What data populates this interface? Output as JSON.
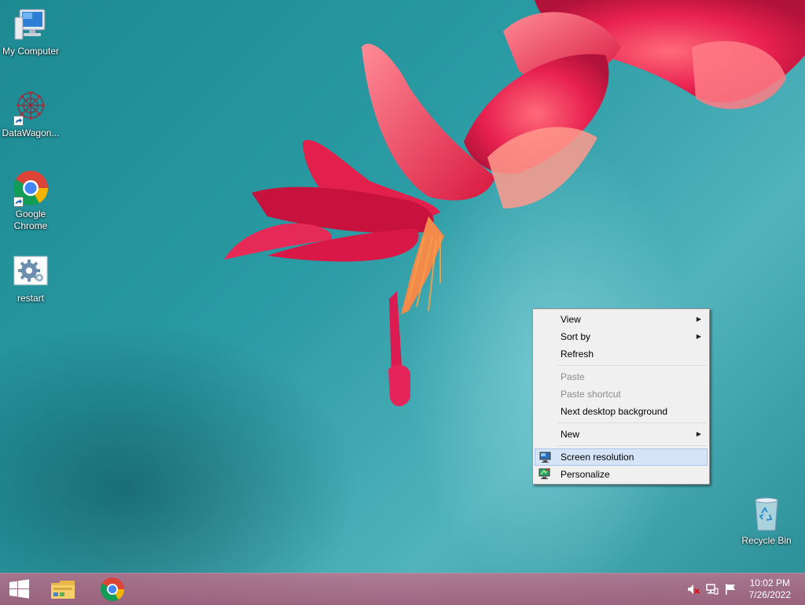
{
  "desktop": {
    "icons": [
      {
        "label": "My Computer",
        "icon": "computer-icon"
      },
      {
        "label": "DataWagon...",
        "icon": "datawagon-icon"
      },
      {
        "label": "Google Chrome",
        "icon": "chrome-icon"
      },
      {
        "label": "restart",
        "icon": "settings-gear-icon"
      },
      {
        "label": "Recycle Bin",
        "icon": "recycle-bin-icon"
      }
    ]
  },
  "context_menu": {
    "items": [
      {
        "label": "View",
        "submenu": true,
        "enabled": true
      },
      {
        "label": "Sort by",
        "submenu": true,
        "enabled": true
      },
      {
        "label": "Refresh",
        "enabled": true
      },
      {
        "label": "Paste",
        "enabled": false
      },
      {
        "label": "Paste shortcut",
        "enabled": false
      },
      {
        "label": "Next desktop background",
        "enabled": true
      },
      {
        "label": "New",
        "submenu": true,
        "enabled": true
      },
      {
        "label": "Screen resolution",
        "enabled": true,
        "highlighted": true,
        "icon": "screen-resolution-icon"
      },
      {
        "label": "Personalize",
        "enabled": true,
        "icon": "personalize-icon"
      }
    ]
  },
  "taskbar": {
    "start_icon": "windows-logo-icon",
    "pinned": [
      "file-explorer-icon",
      "chrome-icon"
    ],
    "tray": [
      "volume-muted-icon",
      "network-icon",
      "action-center-flag-icon"
    ],
    "clock": {
      "time": "10:02 PM",
      "date": "7/26/2022"
    }
  },
  "colors": {
    "menu_highlight": "#d5e5f7",
    "taskbar": "#c46e8c",
    "wallpaper_teal": "#2a9aa3"
  }
}
